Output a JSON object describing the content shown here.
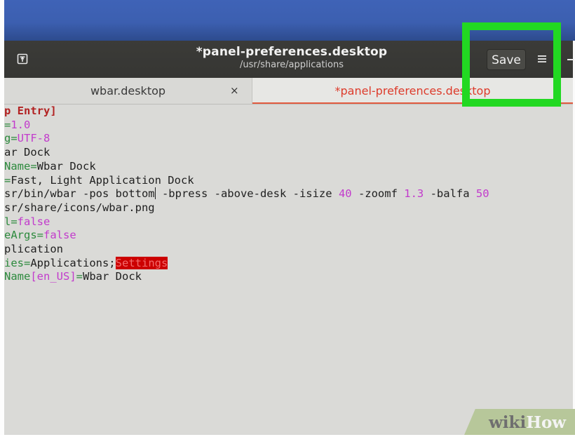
{
  "header": {
    "title": "*panel-preferences.desktop",
    "subtitle": "/usr/share/applications",
    "save_label": "Save"
  },
  "icons": {
    "pin": "pin-icon",
    "menu": "hamburger-menu-icon",
    "minimize": "minimize-icon",
    "tab_close": "close-icon"
  },
  "tabs": [
    {
      "label": "wbar.desktop",
      "close_glyph": "×",
      "active": false
    },
    {
      "label": "*panel-preferences.desktop",
      "active": true
    }
  ],
  "editor": {
    "lines": [
      {
        "parts": [
          {
            "text": "p Entry]",
            "style": "section"
          }
        ]
      },
      {
        "parts": [
          {
            "text": "=",
            "style": "key"
          },
          {
            "text": "1.0",
            "style": "value-number"
          }
        ]
      },
      {
        "parts": [
          {
            "text": "g=",
            "style": "key"
          },
          {
            "text": "UTF-8",
            "style": "value-number"
          }
        ]
      },
      {
        "parts": [
          {
            "text": "ar Dock",
            "style": "plain"
          }
        ]
      },
      {
        "parts": [
          {
            "text": "Name=",
            "style": "key"
          },
          {
            "text": "Wbar Dock",
            "style": "plain"
          }
        ]
      },
      {
        "parts": [
          {
            "text": "=",
            "style": "key"
          },
          {
            "text": "Fast, Light Application Dock",
            "style": "plain"
          }
        ]
      },
      {
        "parts": [
          {
            "text": "sr/bin/wbar -pos bottom",
            "style": "plain"
          },
          {
            "text": "",
            "style": "caret"
          },
          {
            "text": " -bpress -above-desk -isize ",
            "style": "plain"
          },
          {
            "text": "40",
            "style": "value-number"
          },
          {
            "text": " -zoomf ",
            "style": "plain"
          },
          {
            "text": "1.3",
            "style": "value-number"
          },
          {
            "text": " -balfa ",
            "style": "plain"
          },
          {
            "text": "50",
            "style": "value-number"
          }
        ]
      },
      {
        "parts": [
          {
            "text": "sr/share/icons/wbar.png",
            "style": "plain"
          }
        ]
      },
      {
        "parts": [
          {
            "text": "l=",
            "style": "key"
          },
          {
            "text": "false",
            "style": "value-number"
          }
        ]
      },
      {
        "parts": [
          {
            "text": "eArgs=",
            "style": "key"
          },
          {
            "text": "false",
            "style": "value-number"
          }
        ]
      },
      {
        "parts": [
          {
            "text": "plication",
            "style": "plain"
          }
        ]
      },
      {
        "parts": [
          {
            "text": "ies=",
            "style": "key"
          },
          {
            "text": "Applications;",
            "style": "plain"
          },
          {
            "text": "Settings",
            "style": "highlight"
          }
        ]
      },
      {
        "parts": [
          {
            "text": "Name",
            "style": "key"
          },
          {
            "text": "[en_US]",
            "style": "value-number"
          },
          {
            "text": "=",
            "style": "key"
          },
          {
            "text": "Wbar Dock",
            "style": "plain"
          }
        ]
      }
    ]
  },
  "watermark": {
    "wiki": "wiki",
    "how": "How"
  },
  "colors": {
    "highlight_box": "#22d822",
    "active_tab_text": "#dd3b2b",
    "key": "#2c8a3d",
    "value": "#c23bcc",
    "search_highlight": "#cc0000"
  }
}
